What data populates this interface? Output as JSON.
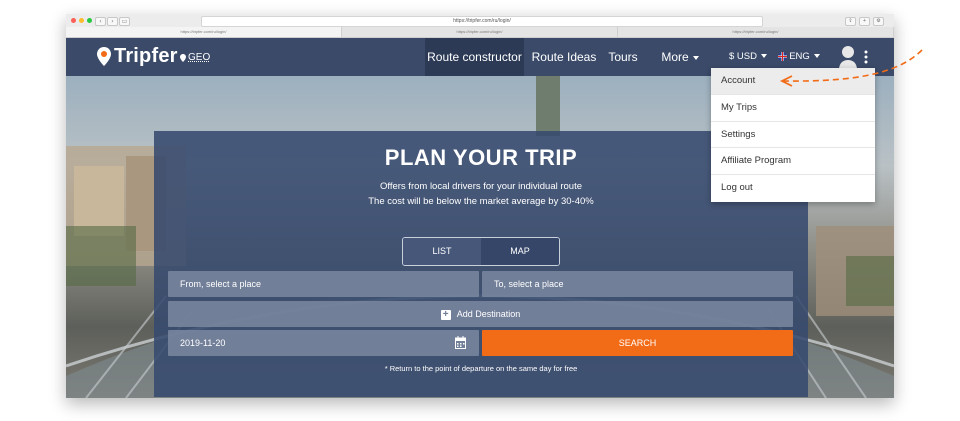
{
  "browser": {
    "url": "https://tripfer.com/ru/login/",
    "tabs": [
      {
        "label": "https://tripfer.com/ru/login/"
      },
      {
        "label": "https://tripfer.com/ru/login/"
      },
      {
        "label": "https://tripfer.com/ru/login/"
      }
    ]
  },
  "site": {
    "logo": "Tripfer",
    "location": "GEO",
    "nav": [
      {
        "label": "Route constructor",
        "active": true
      },
      {
        "label": "Route Ideas"
      },
      {
        "label": "Tours"
      },
      {
        "label": "More"
      }
    ],
    "currency": "$ USD",
    "language": "ENG"
  },
  "dropdown": {
    "items": [
      {
        "label": "Account",
        "highlighted": true
      },
      {
        "label": "My Trips"
      },
      {
        "label": "Settings"
      },
      {
        "label": "Affiliate Program"
      },
      {
        "label": "Log out"
      }
    ]
  },
  "hero": {
    "title": "PLAN YOUR TRIP",
    "subtitle_line1": "Offers from local drivers for your individual route",
    "subtitle_line2": "The cost will be below the market average by 30-40%",
    "view_toggle": [
      "LIST",
      "MAP"
    ],
    "from_placeholder": "From, select a place",
    "to_placeholder": "To, select a place",
    "add_destination": "Add Destination",
    "date": "2019-11-20",
    "search_label": "SEARCH",
    "note": "* Return to the point of departure on the same day for free"
  },
  "colors": {
    "nav_bg": "#3a4a68",
    "accent": "#f26b16",
    "panel": "#374a6e"
  }
}
